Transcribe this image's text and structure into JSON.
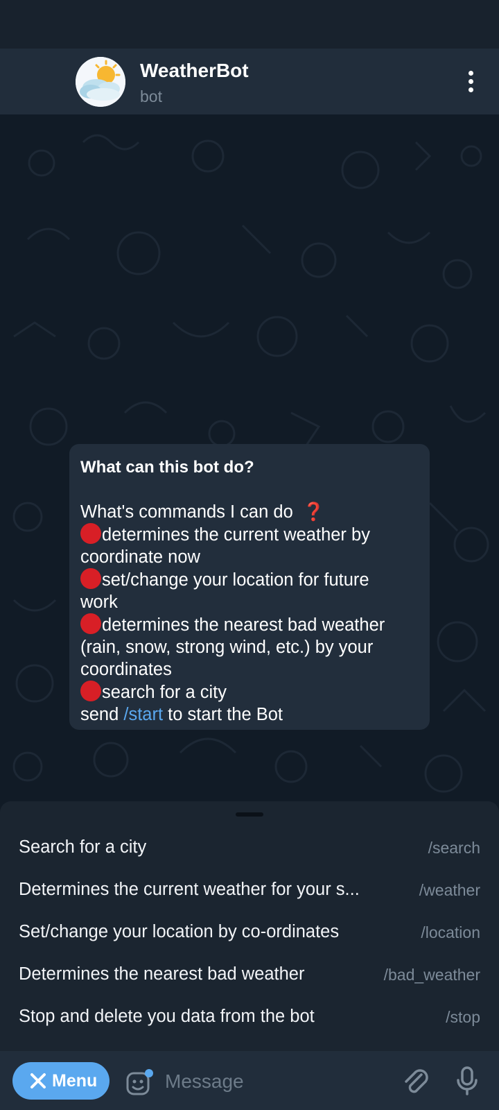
{
  "header": {
    "title": "WeatherBot",
    "subtitle": "bot"
  },
  "intro": {
    "heading": "What can this bot do?",
    "lines": [
      "What's commands I can do",
      "determines the current weather by",
      "coordinate now",
      "set/change your location for future",
      "work",
      "determines the nearest bad weather",
      "(rain, snow, strong wind, etc.) by your",
      "coordinates",
      "search for a city"
    ],
    "send_prefix": "send ",
    "send_link": "/start",
    "send_suffix": " to start the Bot"
  },
  "commands": [
    {
      "description": "Search for a city",
      "command": "/search"
    },
    {
      "description": "Determines the current weather for your s...",
      "command": "/weather"
    },
    {
      "description": "Set/change your location by co-ordinates",
      "command": "/location"
    },
    {
      "description": "Determines the nearest bad weather",
      "command": "/bad_weather"
    },
    {
      "description": "Stop and delete you data from the bot",
      "command": "/stop"
    }
  ],
  "input": {
    "menu_label": "Menu",
    "placeholder": "Message"
  },
  "icons": {
    "avatar": "sun-cloud-avatar-icon",
    "more": "more-vertical-icon",
    "menu_close": "close-icon",
    "sticker": "sticker-icon",
    "attach": "paperclip-icon",
    "mic": "microphone-icon",
    "bullet": "red-circle-emoji",
    "question": "red-question-mark-emoji"
  },
  "colors": {
    "background": "#111b26",
    "header": "#212d3b",
    "bubble": "#222e3c",
    "accent": "#5aa8ef",
    "bullet": "#d81f26",
    "muted": "#7d8b99"
  }
}
